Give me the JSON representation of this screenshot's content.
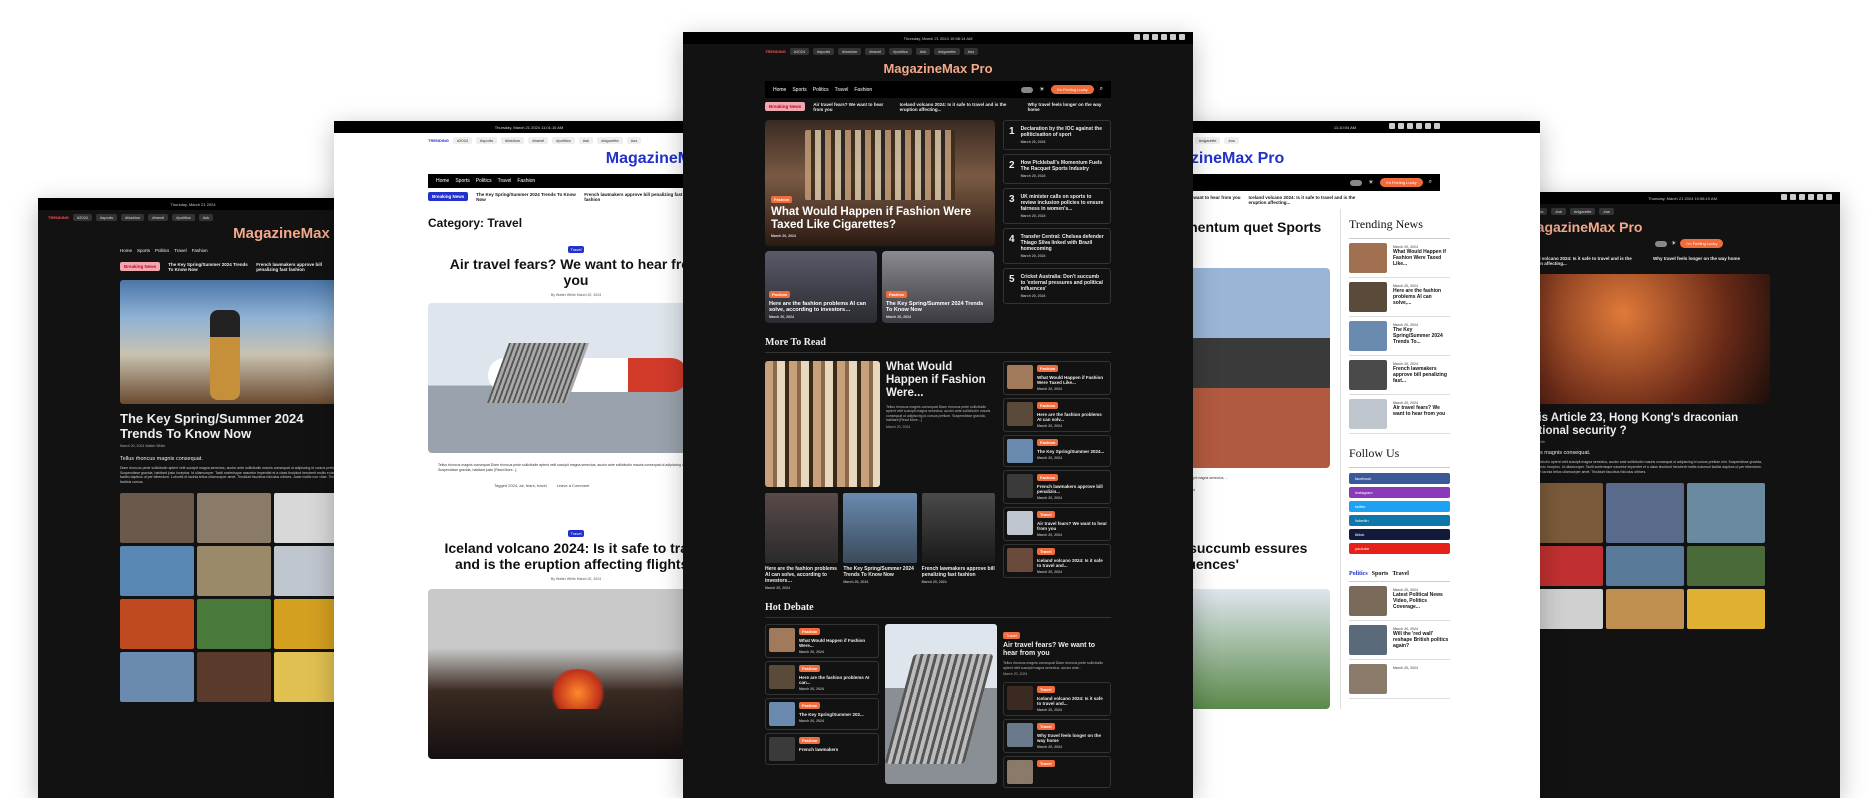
{
  "brand_name": "MagazineMax Pro",
  "brand_short": "MagazineMax P",
  "brand_center": "MagazineMax Pro",
  "brand_right": "MagazineMax Pro",
  "brand_far_right": "MagazineMax Pro",
  "dates": {
    "p1": "Thursday, March 21 2024",
    "p2": "Thursday, March 21 2024     11:01:10 AM",
    "p3": "Thursday, March 21 2024     10:58:14 AM",
    "p4": "11:10:04 AM",
    "p5": "Thursday, March 21 2024     10:58:19 AM"
  },
  "trending_label": "TRENDING",
  "trending_chips": [
    "#2024",
    "#sports",
    "#fashion",
    "#travel",
    "#politics",
    "#uk",
    "#cigarette",
    "#us"
  ],
  "nav": [
    "Home",
    "Sports",
    "Politics",
    "Travel",
    "Fashion"
  ],
  "lucky_btn": "I'm Feeling Lucky",
  "breaking_label": "Breaking News",
  "ticker": [
    "Air travel fears? We want to hear from you",
    "Iceland volcano 2024: Is it safe to travel and is the eruption affecting...",
    "Why travel feels longer on the way home"
  ],
  "ticker_p1": [
    "The Key Spring/Summer 2024 Trends To Know Now",
    "French lawmakers approve bill penalizing fast fashion"
  ],
  "ticker_p2": [
    "The Key Spring/Summer 2024 Trends To Know Now",
    "French lawmakers approve bill penalizing fast fashion"
  ],
  "ticker_p4": [
    "Air travel fears? We want to hear from you",
    "Iceland volcano 2024: Is it safe to travel and is the eruption affecting..."
  ],
  "ticker_p5": [
    "Iceland volcano 2024: Is it safe to travel and is the eruption affecting...",
    "Why travel feels longer on the way home"
  ],
  "hero": {
    "tag": "Fashion",
    "title": "What Would Happen if Fashion Were Taxed Like Cigarettes?",
    "date": "March 20, 2024"
  },
  "hero_small": [
    {
      "tag": "Fashion",
      "title": "Here are the fashion problems AI can solve, according to investors…",
      "date": "March 20, 2024"
    },
    {
      "tag": "Fashion",
      "title": "The Key Spring/Summer 2024 Trends To Know Now",
      "date": "March 20, 2024"
    }
  ],
  "ranked": [
    {
      "n": "1",
      "title": "Declaration by the IOC against the politicisation of sport",
      "date": "March 20, 2024"
    },
    {
      "n": "2",
      "title": "How Pickleball's Momentum Fuels The Racquet Sports Industry",
      "date": "March 20, 2024"
    },
    {
      "n": "3",
      "title": "UK minister calls on sports to review inclusion policies to ensure fairness in women's...",
      "date": "March 20, 2024"
    },
    {
      "n": "4",
      "title": "Transfer Central: Chelsea defender Thiago Silva linked with Brazil homecoming",
      "date": "March 20, 2024"
    },
    {
      "n": "5",
      "title": "Cricket Australia: Don't succumb to 'external pressures and political influences'",
      "date": "March 20, 2024"
    }
  ],
  "more_to_read": "More To Read",
  "mtr_main": {
    "title": "What Would Happen if Fashion Were...",
    "excerpt": "Tellus rhoncus magnis consequat Diam rhoncus pede sollicitudin aptent velit suscipit magna senectus, auctor ante sollicitudin mauris consequat ut adipiscing id cursus pretium. Suspendisse gravida, habitant [Read More...]",
    "date": "March 20, 2024"
  },
  "mtr_grid": [
    {
      "title": "Here are the fashion problems AI can solve, according to investors…",
      "date": "March 20, 2024"
    },
    {
      "title": "The Key Spring/Summer 2024 Trends To Know Now",
      "date": "March 20, 2024"
    },
    {
      "title": "French lawmakers approve bill penalizing fast fashion",
      "date": "March 20, 2024"
    }
  ],
  "mtr_side": [
    {
      "tag": "Fashion",
      "title": "What Would Happen if Fashion Were Taxed Like...",
      "date": "March 20, 2024"
    },
    {
      "tag": "Fashion",
      "title": "Here are the fashion problems AI can solv...",
      "date": "March 20, 2024"
    },
    {
      "tag": "Fashion",
      "title": "The Key Spring/Summer 2024...",
      "date": "March 20, 2024"
    },
    {
      "tag": "Fashion",
      "title": "French lawmakers approve bill penalizin...",
      "date": "March 20, 2024"
    },
    {
      "tag": "Travel",
      "title": "Air travel fears? We want to hear from you",
      "date": "March 20, 2024"
    },
    {
      "tag": "Travel",
      "title": "Iceland volcano 2024: Is it safe to travel and...",
      "date": "March 20, 2024"
    }
  ],
  "hot_debate": "Hot Debate",
  "hd_left": [
    {
      "tag": "Fashion",
      "title": "What Would Happen if Fashion Were...",
      "date": "March 20, 2024"
    },
    {
      "tag": "Fashion",
      "title": "Here are the fashion problems AI can...",
      "date": "March 20, 2024"
    },
    {
      "tag": "Fashion",
      "title": "The Key Spring/Summer 202...",
      "date": "March 20, 2024"
    },
    {
      "tag": "Fashion",
      "title": "French lawmakers",
      "date": ""
    }
  ],
  "hd_main": {
    "tag": "Travel",
    "title": "Air travel fears? We want to hear from you",
    "excerpt": "Tellus rhoncus magnis consequat Diam rhoncus pede sollicitudin aptent velit suscipit magna senectus, auctor ante...",
    "date": "March 20, 2024"
  },
  "hd_right": [
    {
      "tag": "Travel",
      "title": "Iceland volcano 2024: Is it safe to travel and...",
      "date": "March 20, 2024"
    },
    {
      "tag": "Travel",
      "title": "Why travel feels longer on the way home",
      "date": "March 20, 2024"
    },
    {
      "tag": "Travel",
      "title": "",
      "date": ""
    }
  ],
  "p1": {
    "title": "The Key Spring/Summer 2024 Trends To Know Now",
    "meta": "March 20, 2024   Walter White",
    "lead": "Tellus rhoncus magnis consequat.",
    "body": "Diam rhoncus pede sollicitudin aptent velit suscipit magna senectus, auctor ante sollicitudin mauris consequat ut adipiscing id cursus pretium nisi. Suspendisse gravida, habitant justo inceptos. Id ullamcorper. Taciti scelerisque nascetur imperdiet et a class tincidunt hendrerit mollis euismod facilisi dapibus ut per bibendum. Lobortis et lacinia tellus ullamcorper amet. Tincidunt faucibus ridiculus ultrices. Justo mollis non vitae. Tincidunt facilisis cursus."
  },
  "p2": {
    "category": "Category: Travel",
    "a1": {
      "tag": "Travel",
      "title": "Air travel fears? We want to hear from you",
      "meta": "By Walter White  March 20, 2024"
    },
    "a1_excerpt": "Tellus rhoncus magnis consequat Diam rhoncus pede sollicitudin aptent velit suscipit magna senectus, auctor ante sollicitudin mauris consequat ut adipiscing id cursus pretium nisi. Suspendisse gravida, habitant justo [Read More...]",
    "a1_tags": "Tagged 2024, air, fears, travel",
    "a1_comment": "Leave a Comment",
    "a2": {
      "tag": "Travel",
      "title": "Iceland volcano 2024: Is it safe to travel and is the eruption affecting flights?",
      "meta": "By Walter White  March 20, 2024"
    }
  },
  "p4": {
    "a1_title": "'s Momentum quet Sports stry",
    "a1_date": "March 20, 2024",
    "a1_excerpt": "sollicitudin aptent velit suscipit magna senectus, ...",
    "a1_links": "sports     Leave a Comment",
    "a2_title": "Don't succumb essures and fluences'",
    "a2_date": "March 20, 2024",
    "trending": "Trending News",
    "trending_items": [
      {
        "date": "March 20, 2024",
        "title": "What Would Happen if Fashion Were Taxed Like..."
      },
      {
        "date": "March 20, 2024",
        "title": "Here are the fashion problems AI can solve,..."
      },
      {
        "date": "March 20, 2024",
        "title": "The Key Spring/Summer 2024 Trends To..."
      },
      {
        "date": "March 20, 2024",
        "title": "French lawmakers approve bill penalizing fast..."
      },
      {
        "date": "March 20, 2024",
        "title": "Air travel fears? We want to hear from you"
      }
    ],
    "follow": "Follow Us",
    "social": [
      {
        "label": "facebook",
        "color": "#3b5998"
      },
      {
        "label": "instagram",
        "color": "#8a3ab9"
      },
      {
        "label": "twitter",
        "color": "#1da1f2"
      },
      {
        "label": "linkedin",
        "color": "#0e76a8"
      },
      {
        "label": "tiktok",
        "color": "#111a3a"
      },
      {
        "label": "youtube",
        "color": "#e62117"
      }
    ],
    "tabs": [
      "Politics",
      "Sports",
      "Travel"
    ],
    "tab_items": [
      {
        "date": "March 20, 2024",
        "title": "Latest Political News Video, Politics Coverage..."
      },
      {
        "date": "March 20, 2024",
        "title": "Will the 'red wall' reshape British politics again?"
      },
      {
        "date": "March 20, 2024",
        "title": ""
      }
    ]
  },
  "p5": {
    "title": "at is Article 23, Hong Kong's draconian national security ?",
    "meta": "Walter White",
    "lead": "honcus magnis consequat.",
    "body": "pede sollicitudin aptent velit suscipit magna senectus, auctor ante sollicitudin mauris consequat ut adipiscing id cursus pretium nisi. Suspendisse gravida, habitant justo inceptos. Id ullamcorper. Taciti scelerisque nascetur imperdiet et a class tincidunt hendrerit mollis euismod facilisi dapibus ut per bibendum. Lobortis et lacinia tellus ullamcorper amet. Tincidunt faucibus ridiculus ultrices."
  },
  "colors": {
    "accent": "#f26b3a",
    "brand_light": "#2231c9",
    "dark_bg": "#121212"
  }
}
